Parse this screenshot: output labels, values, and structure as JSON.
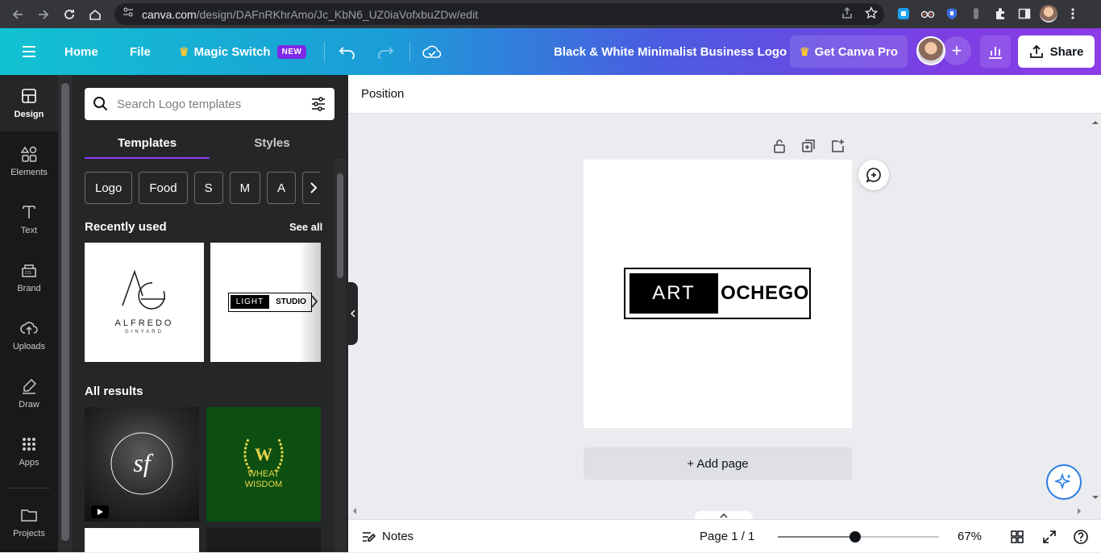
{
  "browser": {
    "url_host": "canva.com",
    "url_path": "/design/DAFnRKhrAmo/Jc_KbN6_UZ0iaVofxbuZDw/edit"
  },
  "topbar": {
    "home": "Home",
    "file": "File",
    "magic_switch": "Magic Switch",
    "new_badge": "NEW",
    "title": "Black & White Minimalist Business Logo",
    "get_pro": "Get Canva Pro",
    "share": "Share"
  },
  "rail": {
    "items": [
      {
        "label": "Design",
        "icon": "layout-icon"
      },
      {
        "label": "Elements",
        "icon": "shapes-icon"
      },
      {
        "label": "Text",
        "icon": "text-icon"
      },
      {
        "label": "Brand",
        "icon": "brand-icon"
      },
      {
        "label": "Uploads",
        "icon": "upload-icon"
      },
      {
        "label": "Draw",
        "icon": "pen-icon"
      },
      {
        "label": "Apps",
        "icon": "apps-icon"
      },
      {
        "label": "Projects",
        "icon": "folder-icon"
      }
    ]
  },
  "panel": {
    "search_placeholder": "Search Logo templates",
    "tabs": [
      "Templates",
      "Styles"
    ],
    "chips": [
      "Logo",
      "Food",
      "S",
      "M",
      "A"
    ],
    "recently_used": "Recently used",
    "see_all": "See all",
    "all_results": "All results",
    "recent": [
      {
        "line1": "ALFREDO",
        "line2": "GINYARD"
      },
      {
        "left": "LIGHT",
        "right": "STUDIO"
      }
    ],
    "results": [
      {
        "text": "sf"
      },
      {
        "letter": "W",
        "line1": "WHEAT",
        "line2": "WISDOM"
      }
    ]
  },
  "editor": {
    "toolbar_position": "Position",
    "logo_left": "ART",
    "logo_right": "OCHEGO",
    "add_page": "+ Add page"
  },
  "statusbar": {
    "notes": "Notes",
    "page_info": "Page 1 / 1",
    "zoom": "67%",
    "zoom_fraction": 0.48
  }
}
